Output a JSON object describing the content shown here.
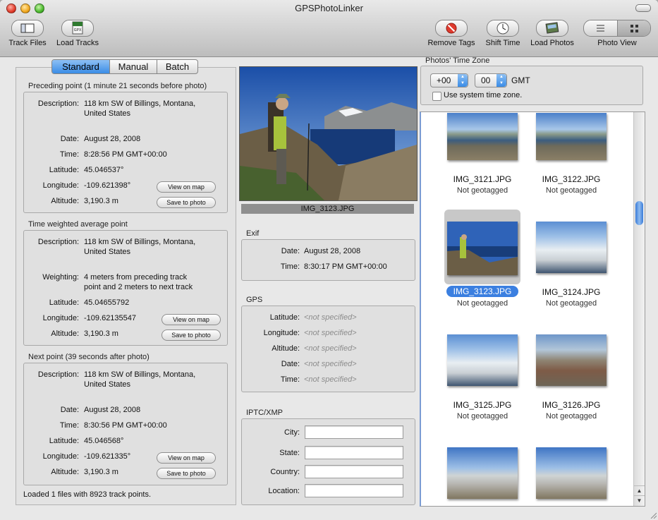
{
  "window": {
    "title": "GPSPhotoLinker"
  },
  "toolbar": {
    "track_files": "Track Files",
    "load_tracks": "Load Tracks",
    "gpx_badge": "GPX",
    "remove_tags": "Remove Tags",
    "shift_time": "Shift Time",
    "load_photos": "Load Photos",
    "photo_view": "Photo View"
  },
  "tabs": {
    "standard": "Standard",
    "manual": "Manual",
    "batch": "Batch"
  },
  "preceding": {
    "title": "Preceding point (1 minute 21 seconds before photo)",
    "description_label": "Description:",
    "description_line1": "118 km SW of Billings, Montana,",
    "description_line2": "United States",
    "date_label": "Date:",
    "date": "August 28, 2008",
    "time_label": "Time:",
    "time": "8:28:56 PM GMT+00:00",
    "latitude_label": "Latitude:",
    "latitude": "45.046537°",
    "longitude_label": "Longitude:",
    "longitude": "-109.621398°",
    "altitude_label": "Altitude:",
    "altitude": "3,190.3 m",
    "view_on_map": "View on map",
    "save_to_photo": "Save to photo"
  },
  "weighted": {
    "title": "Time weighted average point",
    "description_label": "Description:",
    "description_line1": "118 km SW of Billings, Montana,",
    "description_line2": "United States",
    "weighting_label": "Weighting:",
    "weighting_line1": "4 meters from preceding track",
    "weighting_line2": "point and 2 meters to next track",
    "latitude_label": "Latitude:",
    "latitude": "45.04655792",
    "longitude_label": "Longitude:",
    "longitude": "-109.62135547",
    "altitude_label": "Altitude:",
    "altitude": "3,190.3 m",
    "view_on_map": "View on map",
    "save_to_photo": "Save to photo"
  },
  "next": {
    "title": "Next point (39 seconds after photo)",
    "description_label": "Description:",
    "description_line1": "118 km SW of Billings, Montana,",
    "description_line2": "United States",
    "date_label": "Date:",
    "date": "August 28, 2008",
    "time_label": "Time:",
    "time": "8:30:56 PM GMT+00:00",
    "latitude_label": "Latitude:",
    "latitude": "45.046568°",
    "longitude_label": "Longitude:",
    "longitude": "-109.621335°",
    "altitude_label": "Altitude:",
    "altitude": "3,190.3 m",
    "view_on_map": "View on map",
    "save_to_photo": "Save to photo"
  },
  "status": "Loaded 1 files with 8923 track points.",
  "preview": {
    "filename": "IMG_3123.JPG"
  },
  "exif": {
    "title": "Exif",
    "date_label": "Date:",
    "date": "August 28, 2008",
    "time_label": "Time:",
    "time": "8:30:17 PM GMT+00:00"
  },
  "gps": {
    "title": "GPS",
    "latitude_label": "Latitude:",
    "longitude_label": "Longitude:",
    "altitude_label": "Altitude:",
    "date_label": "Date:",
    "time_label": "Time:",
    "not_specified": "<not specified>"
  },
  "iptc": {
    "title": "IPTC/XMP",
    "city_label": "City:",
    "state_label": "State:",
    "country_label": "Country:",
    "location_label": "Location:",
    "city": "",
    "state": "",
    "country": "",
    "location": ""
  },
  "timezone": {
    "title": "Photos' Time Zone",
    "hours": "+00",
    "minutes": "00",
    "gmt": "GMT",
    "use_system": "Use system time zone.",
    "use_system_checked": false
  },
  "photos": [
    {
      "name": "IMG_3121.JPG",
      "status": "Not geotagged",
      "selected": false
    },
    {
      "name": "IMG_3122.JPG",
      "status": "Not geotagged",
      "selected": false
    },
    {
      "name": "IMG_3123.JPG",
      "status": "Not geotagged",
      "selected": true
    },
    {
      "name": "IMG_3124.JPG",
      "status": "Not geotagged",
      "selected": false
    },
    {
      "name": "IMG_3125.JPG",
      "status": "Not geotagged",
      "selected": false
    },
    {
      "name": "IMG_3126.JPG",
      "status": "Not geotagged",
      "selected": false
    }
  ],
  "colors": {
    "accent": "#3b7fe0",
    "selection_bg": "#c8c8c8"
  }
}
